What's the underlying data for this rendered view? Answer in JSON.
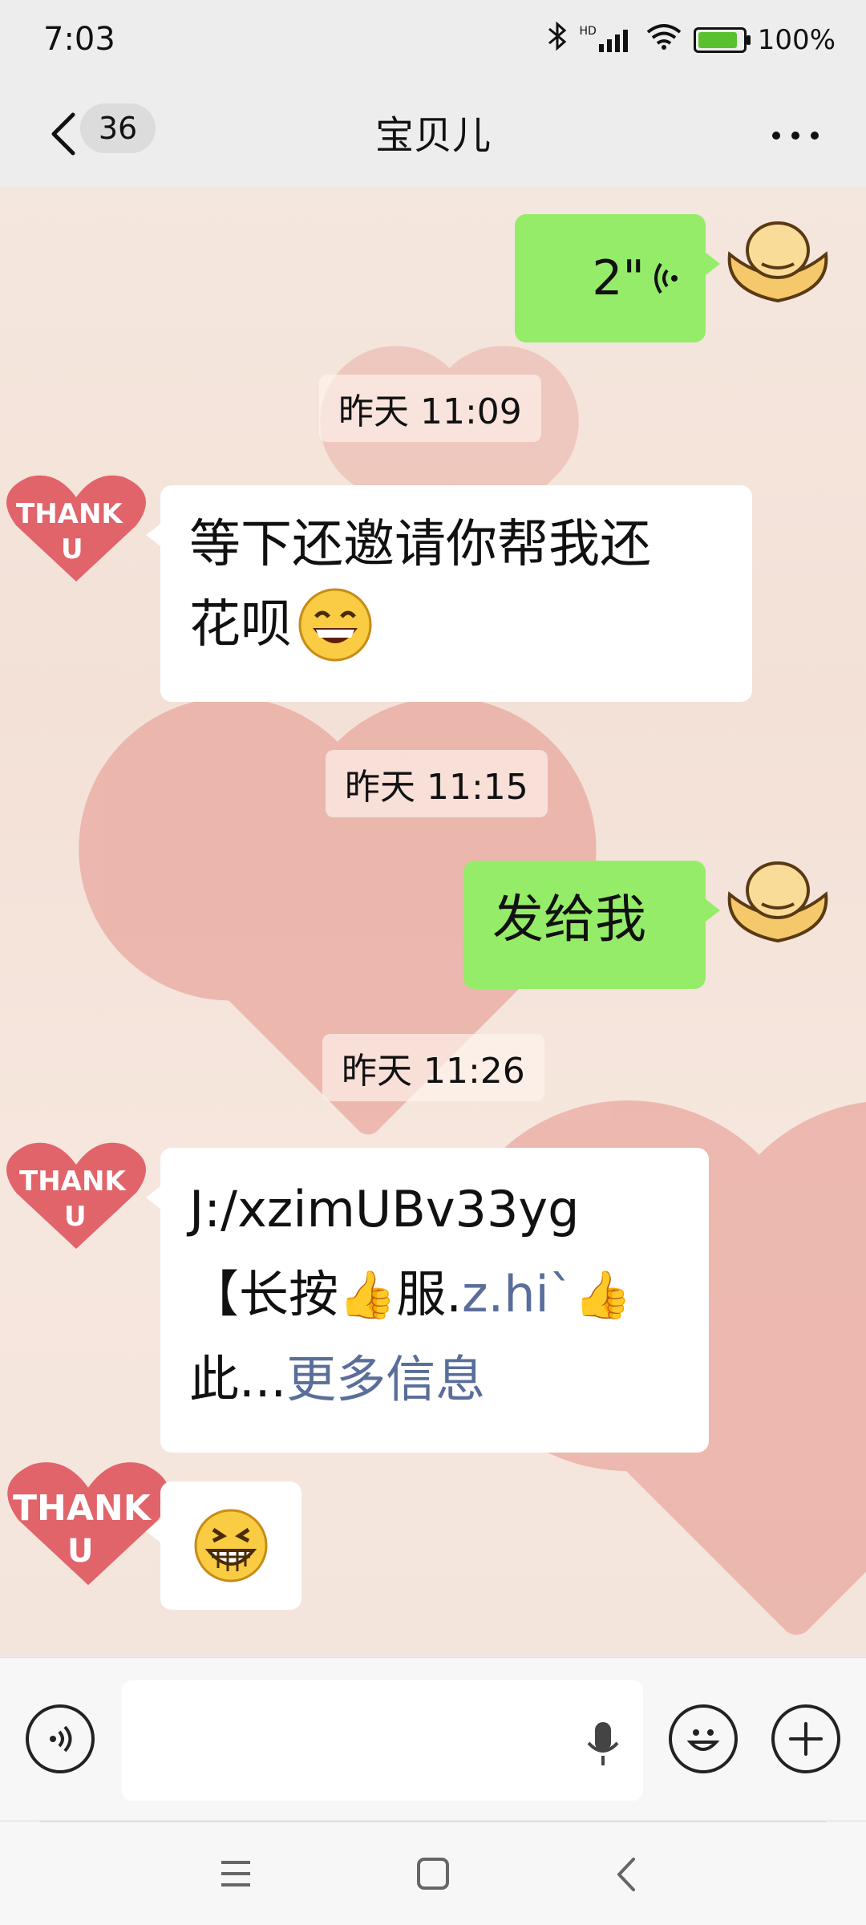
{
  "status_bar": {
    "time": "7:03",
    "network_label": "HD",
    "battery_percent": "100%"
  },
  "header": {
    "unread_count": "36",
    "title": "宝贝儿"
  },
  "messages": [
    {
      "type": "voice",
      "side": "right",
      "duration": "2\""
    },
    {
      "type": "timestamp",
      "text": "昨天 11:09"
    },
    {
      "type": "text",
      "side": "left",
      "line1": "等下还邀请你帮我还",
      "line2": "花呗"
    },
    {
      "type": "timestamp",
      "text": "昨天 11:15"
    },
    {
      "type": "text",
      "side": "right",
      "text": "发给我"
    },
    {
      "type": "timestamp",
      "text": "昨天 11:26"
    },
    {
      "type": "text",
      "side": "left",
      "line1": " J:/xzimUBv33yg",
      "line2_a": "【长按",
      "line2_b": "服.",
      "line2_link": "z.hi`",
      "line3_a": "此...",
      "line3_link": "更多信息"
    },
    {
      "type": "emoji",
      "side": "left",
      "emoji": "grin"
    }
  ],
  "avatar_text": {
    "line1": "THANK",
    "line2": "U"
  },
  "colors": {
    "sent_bubble": "#95ec69",
    "received_bubble": "#ffffff",
    "link": "#5a6e9a"
  }
}
